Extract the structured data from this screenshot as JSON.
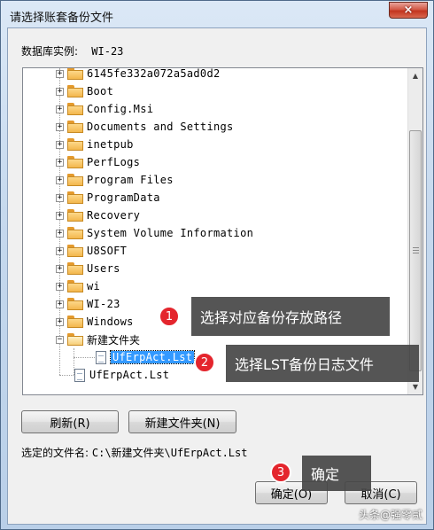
{
  "window": {
    "title": "请选择账套备份文件",
    "close_icon": "×"
  },
  "instance": {
    "label": "数据库实例:",
    "value": "WI-23"
  },
  "tree": {
    "folders": [
      "6145fe332a072a5ad0d2",
      "Boot",
      "Config.Msi",
      "Documents and Settings",
      "inetpub",
      "PerfLogs",
      "Program Files",
      "ProgramData",
      "Recovery",
      "System Volume Information",
      "U8SOFT",
      "Users",
      "wi",
      "WI-23",
      "Windows"
    ],
    "expanded_folder": "新建文件夹",
    "child_file": "UfErpAct.Lst",
    "root_file": "UfErpAct.Lst"
  },
  "buttons": {
    "refresh": "刷新(R)",
    "new_folder": "新建文件夹(N)",
    "ok": "确定(O)",
    "cancel": "取消(C)"
  },
  "selected_file": {
    "label": "选定的文件名:",
    "value": "C:\\新建文件夹\\UfErpAct.Lst"
  },
  "annotations": [
    {
      "number": "1",
      "text": "选择对应备份存放路径"
    },
    {
      "number": "2",
      "text": "选择LST备份日志文件"
    },
    {
      "number": "3",
      "text": "确定"
    }
  ],
  "watermark": "头条@强零贰",
  "colors": {
    "badge": "#e4252d",
    "selection": "#3399ff",
    "callout_bg": "#464646"
  }
}
